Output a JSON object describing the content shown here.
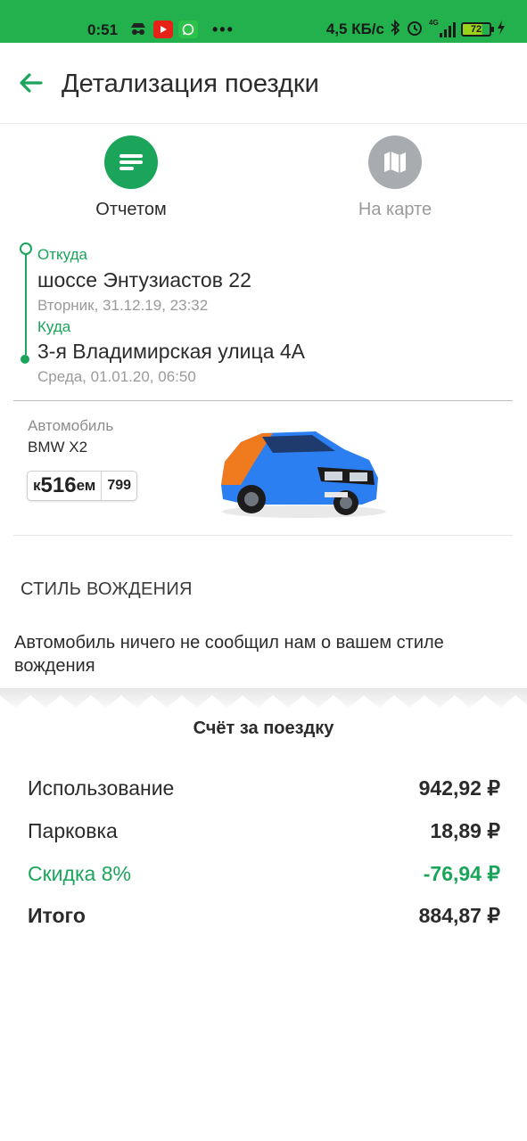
{
  "status_bar": {
    "time": "0:51",
    "more": "•••",
    "speed": "4,5 КБ/с",
    "network": "4G",
    "battery": "72"
  },
  "header": {
    "title": "Детализация поездки"
  },
  "view_toggle": {
    "report_label": "Отчетом",
    "map_label": "На карте"
  },
  "route": {
    "from_label": "Откуда",
    "from_address": "шоссе Энтузиастов 22",
    "from_time": "Вторник, 31.12.19, 23:32",
    "to_label": "Куда",
    "to_address": "3-я Владимирская улица 4А",
    "to_time": "Среда, 01.01.20, 06:50"
  },
  "car": {
    "label": "Автомобиль",
    "model": "BMW X2",
    "plate_letter1": "к",
    "plate_number": "516",
    "plate_letters2": "ем",
    "plate_region": "799"
  },
  "driving_style": {
    "title": "СТИЛЬ ВОЖДЕНИЯ",
    "text": "Автомобиль ничего не сообщил нам о вашем стиле вождения"
  },
  "bill": {
    "title": "Счёт за поездку",
    "rows": [
      {
        "label": "Использование",
        "amount": "942,92 ₽"
      },
      {
        "label": "Парковка",
        "amount": "18,89 ₽"
      },
      {
        "label": "Скидка 8%",
        "amount": "-76,94 ₽"
      },
      {
        "label": "Итого",
        "amount": "884,87 ₽"
      }
    ]
  },
  "colors": {
    "accent": "#1aa55a",
    "status_bar": "#22b14c",
    "inactive": "#a8acb0"
  }
}
